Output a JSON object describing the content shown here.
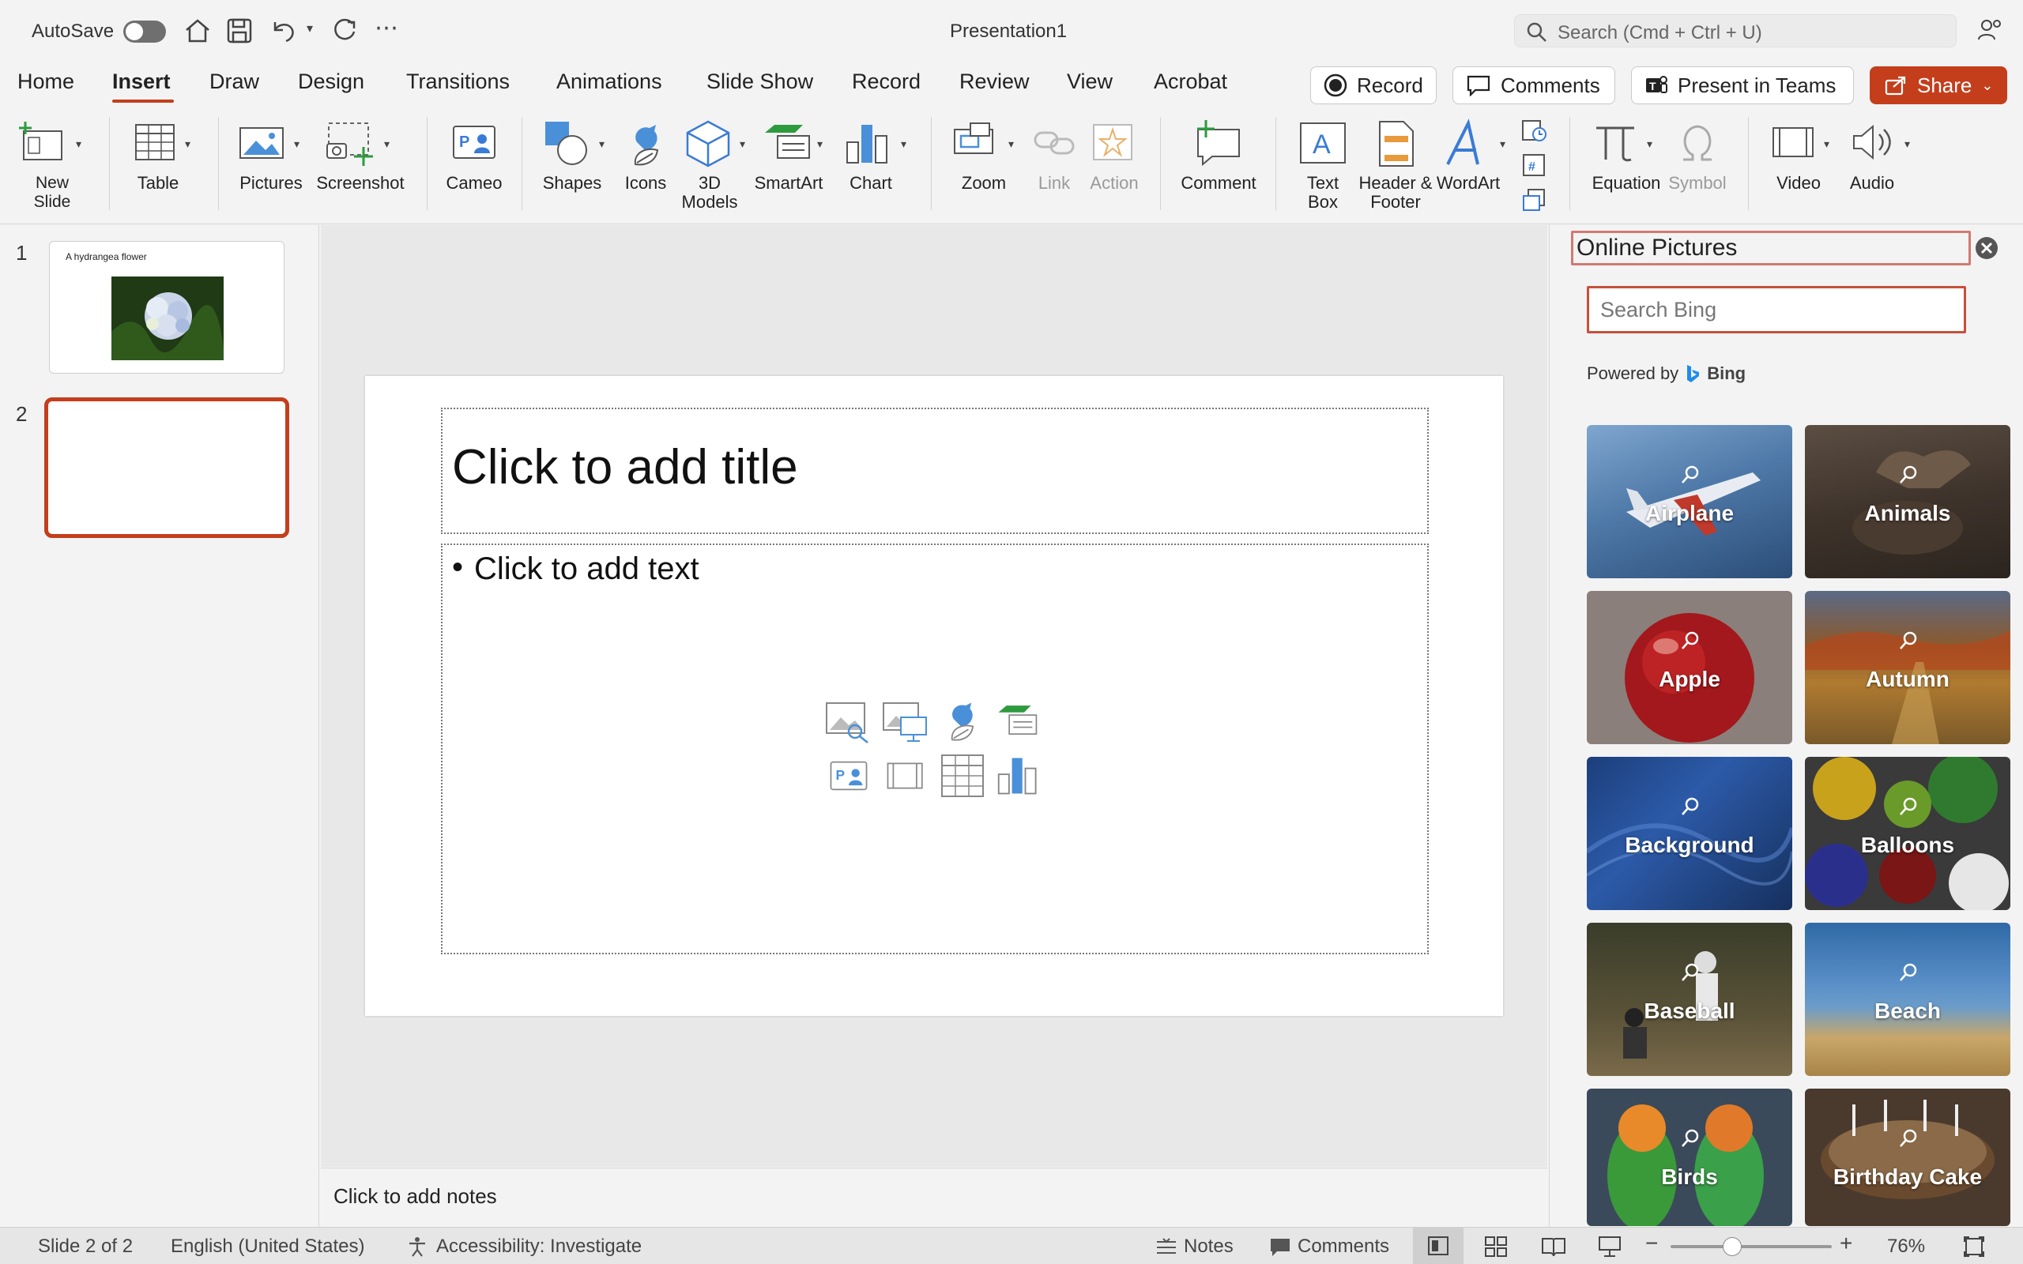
{
  "titlebar": {
    "autosave_label": "AutoSave",
    "doc_title": "Presentation1",
    "search_placeholder": "Search (Cmd + Ctrl + U)"
  },
  "tabs": [
    "Home",
    "Insert",
    "Draw",
    "Design",
    "Transitions",
    "Animations",
    "Slide Show",
    "Record",
    "Review",
    "View",
    "Acrobat"
  ],
  "active_tab": "Insert",
  "header_actions": {
    "record": "Record",
    "comments": "Comments",
    "present_teams": "Present in Teams",
    "share": "Share"
  },
  "ribbon": {
    "new_slide": "New\nSlide",
    "table": "Table",
    "pictures": "Pictures",
    "screenshot": "Screenshot",
    "cameo": "Cameo",
    "shapes": "Shapes",
    "icons": "Icons",
    "models": "3D\nModels",
    "smartart": "SmartArt",
    "chart": "Chart",
    "zoom": "Zoom",
    "link": "Link",
    "action": "Action",
    "comment": "Comment",
    "textbox": "Text\nBox",
    "header_footer": "Header &\nFooter",
    "wordart": "WordArt",
    "equation": "Equation",
    "symbol": "Symbol",
    "video": "Video",
    "audio": "Audio"
  },
  "thumbnails": [
    {
      "num": "1",
      "title": "A hydrangea flower"
    },
    {
      "num": "2",
      "title": ""
    }
  ],
  "slide": {
    "title_placeholder": "Click to add title",
    "body_placeholder": "Click to add text"
  },
  "notes_placeholder": "Click to add notes",
  "pane": {
    "title": "Online Pictures",
    "search_placeholder": "Search Bing",
    "powered_by": "Powered by",
    "bing": "Bing",
    "categories": [
      "Airplane",
      "Animals",
      "Apple",
      "Autumn",
      "Background",
      "Balloons",
      "Baseball",
      "Beach",
      "Birds",
      "Birthday Cake"
    ]
  },
  "status": {
    "slide_count": "Slide 2 of 2",
    "language": "English (United States)",
    "accessibility": "Accessibility: Investigate",
    "notes": "Notes",
    "comments": "Comments",
    "zoom": "76%"
  },
  "colors": {
    "accent": "#c43e1c"
  }
}
